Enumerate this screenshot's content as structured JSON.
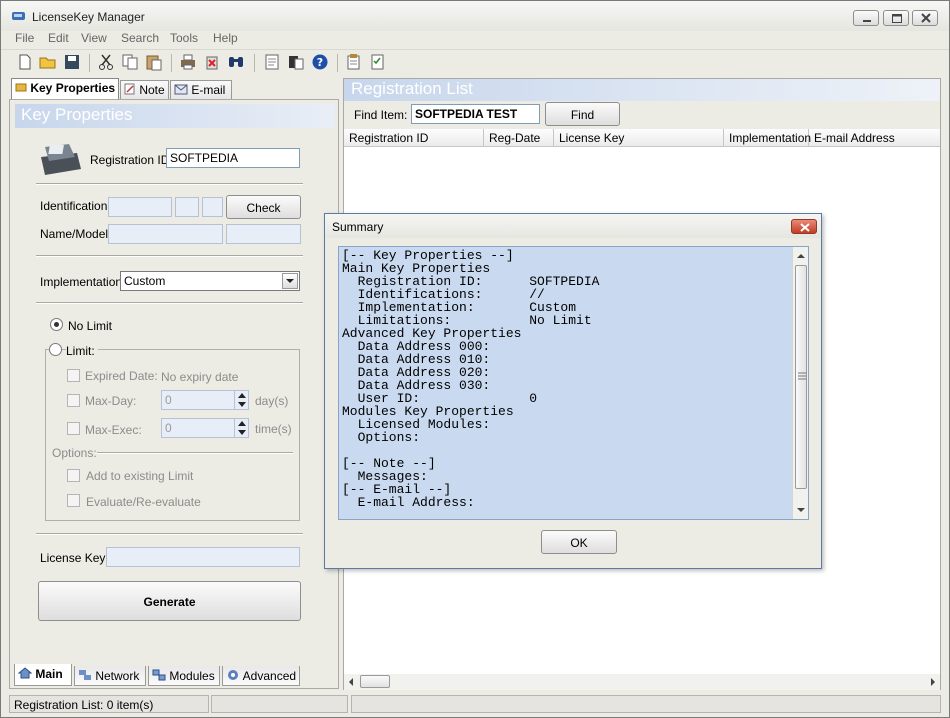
{
  "window": {
    "title": "LicenseKey Manager"
  },
  "menu": [
    "File",
    "Edit",
    "View",
    "Search",
    "Tools",
    "Help"
  ],
  "toolbar": {
    "icons": [
      "new-file-icon",
      "open-folder-icon",
      "save-icon",
      "cut-icon",
      "copy-icon",
      "paste-icon",
      "print-icon",
      "delete-icon",
      "find-icon",
      "document-icon",
      "clipboard-icon",
      "help-icon",
      "properties-icon",
      "checklist-icon"
    ]
  },
  "left": {
    "tabs": [
      "Key Properties",
      "Note",
      "E-mail"
    ],
    "header": "Key Properties",
    "registration_id_label": "Registration ID:",
    "registration_id_value": "SOFTPEDIA",
    "identification_label": "Identification:",
    "check_button": "Check",
    "name_model_label": "Name/Model:",
    "implementation_label": "Implementation:",
    "implementation_value": "Custom",
    "no_limit_label": "No Limit",
    "limit_label": "Limit:",
    "expired_date_label": "Expired Date:",
    "expired_date_value": "No expiry date",
    "max_day_label": "Max-Day:",
    "max_day_value": "0",
    "days_unit": "day(s)",
    "max_exec_label": "Max-Exec:",
    "max_exec_value": "0",
    "time_unit": "time(s)",
    "options_label": "Options:",
    "add_existing_label": "Add to existing Limit",
    "evaluate_label": "Evaluate/Re-evaluate",
    "license_key_label": "License Key:",
    "generate_button": "Generate",
    "bottom_tabs": [
      "Main",
      "Network",
      "Modules",
      "Advanced"
    ]
  },
  "right": {
    "header": "Registration List",
    "find_label": "Find Item:",
    "find_value": "SOFTPEDIA TEST",
    "find_button": "Find",
    "columns": [
      "Registration ID",
      "Reg-Date",
      "License Key",
      "Implementation",
      "E-mail Address"
    ]
  },
  "status": {
    "text": "Registration List: 0 item(s)"
  },
  "dialog": {
    "title": "Summary",
    "ok_button": "OK",
    "summary": "[-- Key Properties --]\nMain Key Properties\n  Registration ID:      SOFTPEDIA\n  Identifications:      //\n  Implementation:       Custom\n  Limitations:          No Limit\nAdvanced Key Properties\n  Data Address 000:\n  Data Address 010:\n  Data Address 020:\n  Data Address 030:\n  User ID:              0\nModules Key Properties\n  Licensed Modules:\n  Options:\n\n[-- Note --]\n  Messages:\n[-- E-mail --]\n  E-mail Address:"
  },
  "colors": {
    "header_blue": "#c7d6ec",
    "summary_bg": "#c9daf0",
    "close_red": "#c33d24"
  }
}
